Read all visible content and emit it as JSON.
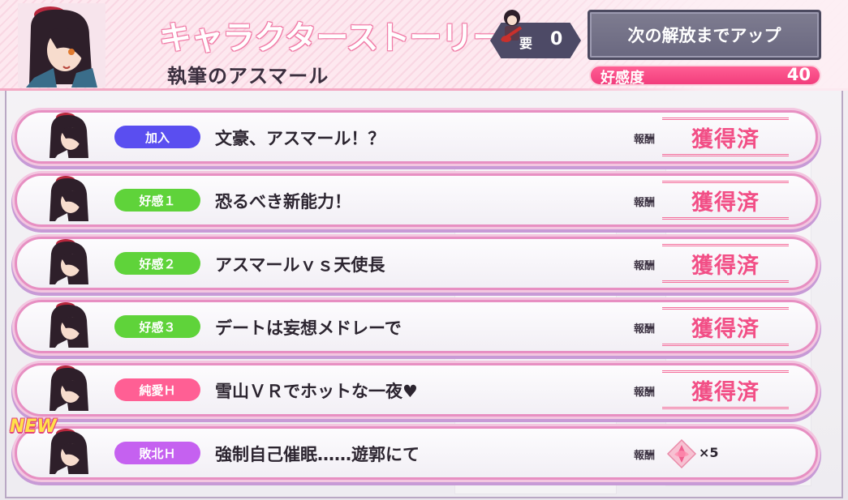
{
  "header": {
    "title": "キャラクターストーリー",
    "character_name": "執筆のアスマール",
    "requirement_label": "要",
    "requirement_value": "0",
    "unlock_button_label": "次の解放までアップ",
    "affinity_label": "好感度",
    "affinity_value": "40"
  },
  "colors": {
    "accent_pink": "#f24f86",
    "badge_join": "#5a4ef0",
    "badge_affinity": "#5fd33a",
    "badge_love": "#ff5f94",
    "badge_defeat": "#c561f0"
  },
  "stories": [
    {
      "badge": "加入",
      "badge_color": "#5a4ef0",
      "title": "文豪、アスマール！？",
      "reward_label": "報酬",
      "reward_status": "獲得済"
    },
    {
      "badge": "好感１",
      "badge_color": "#5fd33a",
      "title": "恐るべき新能力！",
      "reward_label": "報酬",
      "reward_status": "獲得済"
    },
    {
      "badge": "好感２",
      "badge_color": "#5fd33a",
      "title": "アスマールｖｓ天使長",
      "reward_label": "報酬",
      "reward_status": "獲得済"
    },
    {
      "badge": "好感３",
      "badge_color": "#5fd33a",
      "title": "デートは妄想メドレーで",
      "reward_label": "報酬",
      "reward_status": "獲得済"
    },
    {
      "badge": "純愛Ｈ",
      "badge_color": "#ff5f94",
      "title": "雪山ＶＲでホットな一夜♥",
      "reward_label": "報酬",
      "reward_status": "獲得済"
    },
    {
      "badge": "敗北Ｈ",
      "badge_color": "#c561f0",
      "title": "強制自己催眠……遊郭にて",
      "reward_label": "報酬",
      "reward_count": "×5",
      "new_label": "NEW"
    }
  ],
  "icons": {
    "portrait": "character-portrait",
    "requirement": "guitar-character-icon",
    "reward": "crystal-gem-icon"
  }
}
